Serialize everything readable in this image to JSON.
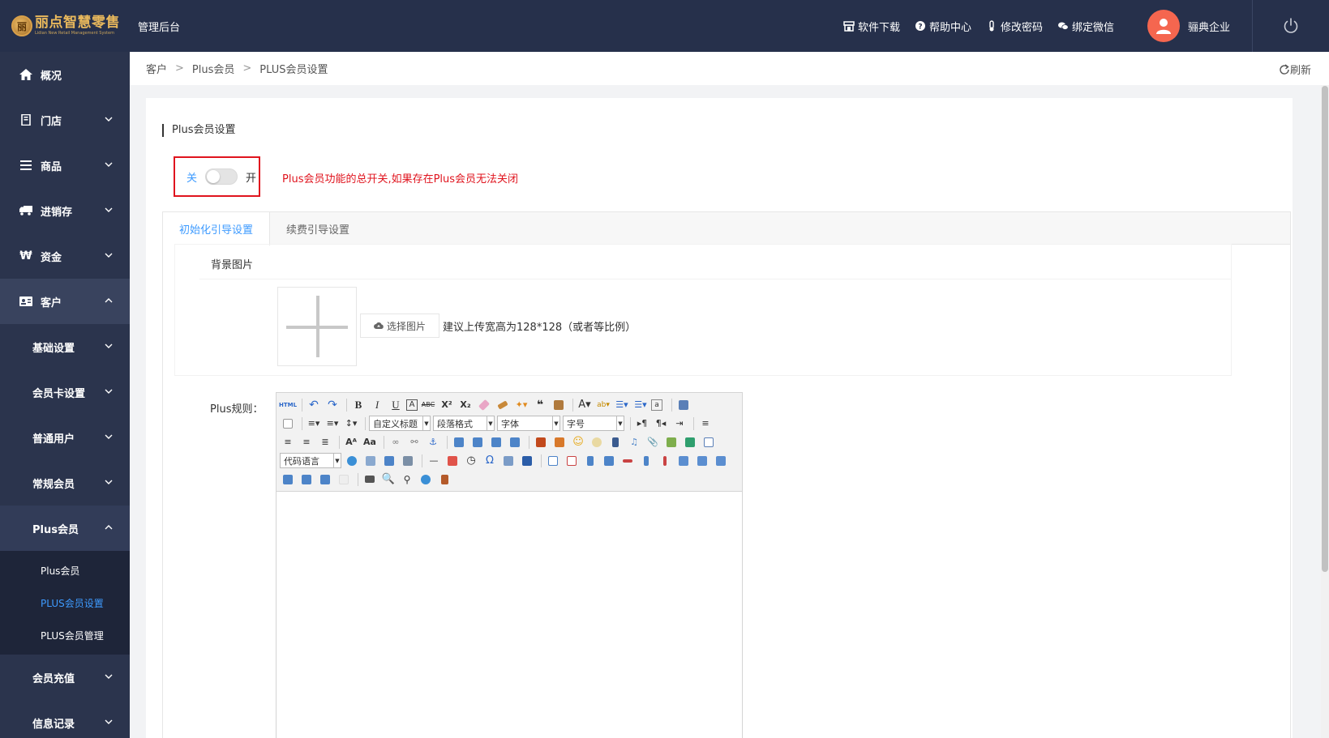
{
  "header": {
    "brand": "丽点智慧零售",
    "brand_sub": "Lidian New Retail Management System",
    "app_title": "管理后台",
    "links": [
      {
        "label": "软件下载",
        "icon": "store-icon"
      },
      {
        "label": "帮助中心",
        "icon": "question-circle-icon"
      },
      {
        "label": "修改密码",
        "icon": "thermometer-icon"
      },
      {
        "label": "绑定微信",
        "icon": "wechat-icon"
      }
    ],
    "user_name": "骊典企业"
  },
  "sidebar": {
    "items": [
      {
        "label": "概况",
        "icon": "home-icon"
      },
      {
        "label": "门店",
        "icon": "store-door-icon"
      },
      {
        "label": "商品",
        "icon": "list-icon"
      },
      {
        "label": "进销存",
        "icon": "truck-icon"
      },
      {
        "label": "资金",
        "icon": "won-icon"
      },
      {
        "label": "客户",
        "icon": "contact-card-icon"
      }
    ],
    "customer_sub": [
      {
        "label": "基础设置"
      },
      {
        "label": "会员卡设置"
      },
      {
        "label": "普通用户"
      },
      {
        "label": "常规会员"
      },
      {
        "label": "Plus会员"
      }
    ],
    "plus_leaves": [
      {
        "label": "Plus会员"
      },
      {
        "label": "PLUS会员设置"
      },
      {
        "label": "PLUS会员管理"
      }
    ],
    "after_sub": [
      {
        "label": "会员充值"
      },
      {
        "label": "信息记录"
      }
    ]
  },
  "breadcrumb": {
    "items": [
      "客户",
      "Plus会员",
      "PLUS会员设置"
    ],
    "separator": ">",
    "refresh_label": "刷新"
  },
  "main": {
    "section_title": "Plus会员设置",
    "toggle": {
      "off_label": "关",
      "on_label": "开",
      "enabled": false
    },
    "toggle_hint": "Plus会员功能的总开关,如果存在Plus会员无法关闭",
    "tabs": [
      {
        "label": "初始化引导设置",
        "active": true
      },
      {
        "label": "续费引导设置",
        "active": false
      }
    ],
    "bg_label": "背景图片",
    "choose_btn": "选择图片",
    "upload_hint": "建议上传宽高为128*128（或者等比例）",
    "rule_label": "Plus规则："
  },
  "editor": {
    "selects": {
      "heading": "自定义标题",
      "paragraph": "段落格式",
      "font": "字体",
      "size": "字号",
      "code_lang": "代码语言"
    },
    "html_label": "HTML"
  },
  "colors": {
    "topbar": "#26304b",
    "sidebar": "#2b344d",
    "accent": "#3e9bff",
    "danger": "#e0141e",
    "avatar": "#f5664f"
  }
}
